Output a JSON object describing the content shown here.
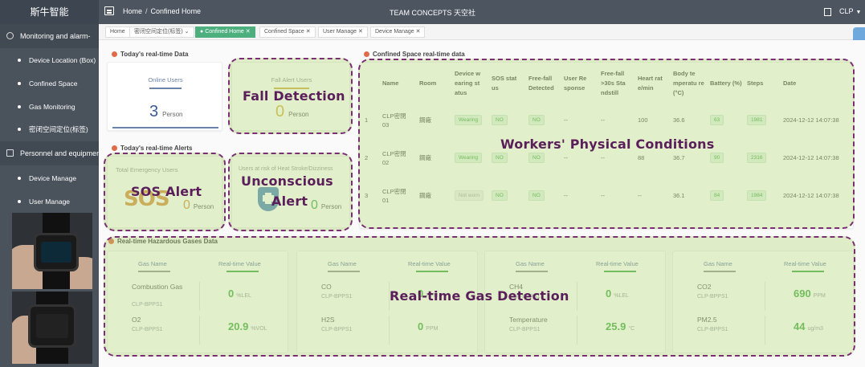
{
  "topbar": {
    "brand": "斯牛智能",
    "breadcrumb_home": "Home",
    "breadcrumb_sep": "/",
    "breadcrumb_current": "Confined Home",
    "title": "TEAM CONCEPTS 天空社",
    "user": "CLP"
  },
  "sidebar": {
    "group1": "Monitoring and alarm-",
    "items1": [
      "Device Location (Box)",
      "Confined Space",
      "Gas Monitoring",
      "密闭空间定位(标签)"
    ],
    "group2": "Personnel and equipment",
    "items2": [
      "Device Manage",
      "User Manage"
    ]
  },
  "tabs": [
    "Home",
    "密闭空间定位(标签)",
    "Confined Home",
    "Confined Space",
    "User Manage",
    "Device Manage"
  ],
  "realtime_data": {
    "title": "Today's real-time Data",
    "online_label": "Online Users",
    "online_value": "3",
    "online_unit": "Person",
    "fall_label": "Fall Alert Users",
    "fall_value": "0",
    "fall_unit": "Person"
  },
  "alerts": {
    "title": "Today's real-time Alerts",
    "emergency_label": "Total Emergency Users",
    "emergency_value": "0",
    "emergency_unit": "Person",
    "sos_badge": "SOS",
    "heat_label": "Users at risk of Heat Stroke/Dizziness",
    "heat_value": "0",
    "heat_unit": "Person"
  },
  "table": {
    "title": "Confined Space real-time data",
    "columns": [
      "",
      "Name",
      "Room",
      "Device w earing st atus",
      "SOS stat us",
      "Free-fall Detected",
      "User Re sponse",
      "Free-fall >30s Sta ndstill",
      "Heart rat e/min",
      "Body te mperatu re (°C)",
      "Battery (%)",
      "Steps",
      "Date"
    ],
    "rows": [
      {
        "idx": "1",
        "name": "CLP密閉 03",
        "room": "鋼廠",
        "wear": "Wearing",
        "sos": "NO",
        "fall": "NO",
        "resp": "--",
        "still": "--",
        "hr": "100",
        "temp": "36.6",
        "bat": "63",
        "steps": "1981",
        "date": "2024-12-12 14:07:38"
      },
      {
        "idx": "2",
        "name": "CLP密閉 02",
        "room": "鋼廠",
        "wear": "Wearing",
        "sos": "NO",
        "fall": "NO",
        "resp": "--",
        "still": "--",
        "hr": "88",
        "temp": "36.7",
        "bat": "90",
        "steps": "2316",
        "date": "2024-12-12 14:07:38"
      },
      {
        "idx": "3",
        "name": "CLP密閉 01",
        "room": "鋼廠",
        "wear": "Not worn",
        "sos": "NO",
        "fall": "NO",
        "resp": "--",
        "still": "--",
        "hr": "--",
        "temp": "36.1",
        "bat": "84",
        "steps": "1984",
        "date": "2024-12-12 14:07:38"
      }
    ]
  },
  "gas": {
    "title": "Real-time Hazardous Gases Data",
    "header_name": "Gas Name",
    "header_value": "Real-time Value",
    "cards": [
      {
        "items": [
          {
            "name": "Combustion Gas",
            "device": "CLP-BPPS1",
            "value": "0",
            "unit": "%LEL"
          },
          {
            "name": "O2",
            "device": "CLP-BPPS1",
            "value": "20.9",
            "unit": "%VOL"
          }
        ]
      },
      {
        "items": [
          {
            "name": "CO",
            "device": "CLP-BPPS1",
            "value": "0",
            "unit": "PPM"
          },
          {
            "name": "H2S",
            "device": "CLP-BPPS1",
            "value": "0",
            "unit": "PPM"
          }
        ]
      },
      {
        "items": [
          {
            "name": "CH4",
            "device": "CLP-BPPS1",
            "value": "0",
            "unit": "%LEL"
          },
          {
            "name": "Temperature",
            "device": "CLP-BPPS1",
            "value": "25.9",
            "unit": "°C"
          }
        ]
      },
      {
        "items": [
          {
            "name": "CO2",
            "device": "CLP-BPPS1",
            "value": "690",
            "unit": "PPM"
          },
          {
            "name": "PM2.5",
            "device": "CLP-BPPS1",
            "value": "44",
            "unit": "ug/m3"
          }
        ]
      }
    ]
  },
  "annotations": {
    "fall": "Fall Detection",
    "sos": "SOS Alert",
    "unconscious_line1": "Unconscious",
    "unconscious_line2": "Alert",
    "workers": "Workers' Physical Conditions",
    "gas": "Real-time Gas Detection"
  },
  "colors": {
    "accent": "#4caf7d",
    "annotation_border": "#7a2f73",
    "highlight_fill": "rgba(178,212,118,0.38)",
    "value_green": "#4caf50",
    "online_blue": "#3a5a9a"
  }
}
